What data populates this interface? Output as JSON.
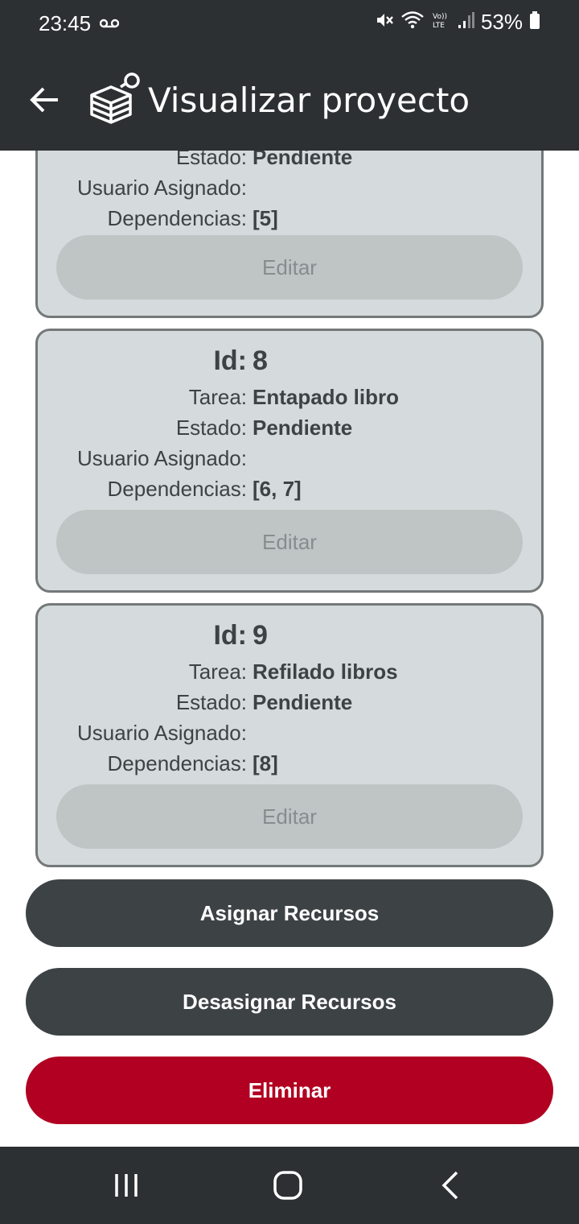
{
  "status_bar": {
    "time": "23:45",
    "battery": "53%",
    "icons": [
      "voicemail-icon",
      "mute-icon",
      "wifi-icon",
      "volte-icon",
      "signal-icon",
      "battery-icon"
    ]
  },
  "app_bar": {
    "title": "Visualizar proyecto",
    "back_icon": "arrow-left-icon",
    "logo_icon": "boxes-stack-icon"
  },
  "labels": {
    "id": "Id:",
    "task": "Tarea:",
    "state": "Estado:",
    "user": "Usuario Asignado:",
    "deps": "Dependencias:",
    "edit": "Editar"
  },
  "tasks": [
    {
      "state": "Pendiente",
      "user": "",
      "deps": "[5]"
    },
    {
      "id": "8",
      "task": "Entapado libro",
      "state": "Pendiente",
      "user": "",
      "deps": "[6, 7]"
    },
    {
      "id": "9",
      "task": "Refilado libros",
      "state": "Pendiente",
      "user": "",
      "deps": "[8]"
    }
  ],
  "actions": {
    "assign": "Asignar Recursos",
    "unassign": "Desasignar Recursos",
    "delete": "Eliminar"
  },
  "colors": {
    "bar": "#2c3032",
    "card_bg": "#d5dbdc",
    "card_border": "#747878",
    "dark_button": "#3d4245",
    "danger": "#b10021"
  }
}
